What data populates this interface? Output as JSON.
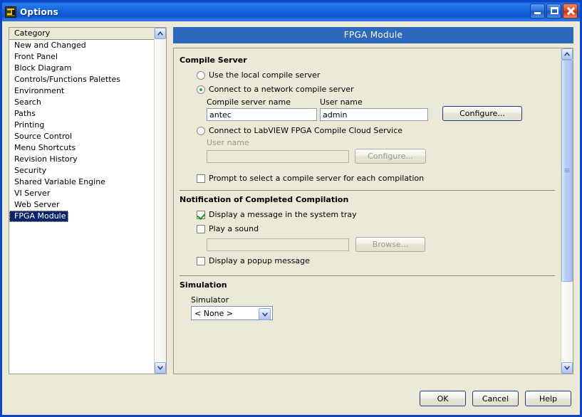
{
  "window": {
    "title": "Options",
    "icon": "labview-icon",
    "controls": {
      "minimize": "minimize-icon",
      "maximize": "maximize-icon",
      "close": "close-icon"
    }
  },
  "sidebar": {
    "header": "Category",
    "items": [
      {
        "label": "New and Changed",
        "selected": false
      },
      {
        "label": "Front Panel",
        "selected": false
      },
      {
        "label": "Block Diagram",
        "selected": false
      },
      {
        "label": "Controls/Functions Palettes",
        "selected": false
      },
      {
        "label": "Environment",
        "selected": false
      },
      {
        "label": "Search",
        "selected": false
      },
      {
        "label": "Paths",
        "selected": false
      },
      {
        "label": "Printing",
        "selected": false
      },
      {
        "label": "Source Control",
        "selected": false
      },
      {
        "label": "Menu Shortcuts",
        "selected": false
      },
      {
        "label": "Revision History",
        "selected": false
      },
      {
        "label": "Security",
        "selected": false
      },
      {
        "label": "Shared Variable Engine",
        "selected": false
      },
      {
        "label": "VI Server",
        "selected": false
      },
      {
        "label": "Web Server",
        "selected": false
      },
      {
        "label": "FPGA Module",
        "selected": true
      }
    ]
  },
  "panel": {
    "title": "FPGA Module",
    "sections": {
      "compile_server": {
        "title": "Compile Server",
        "radio_local": "Use the local compile server",
        "radio_network": "Connect to a network compile server",
        "radio_cloud": "Connect to LabVIEW FPGA Compile Cloud Service",
        "server_name_label": "Compile server name",
        "server_name_value": "antec",
        "user_name_label": "User name",
        "user_name_value": "admin",
        "configure_button": "Configure...",
        "cloud_user_name_label": "User name",
        "cloud_user_name_value": "",
        "cloud_configure_button": "Configure...",
        "prompt_checkbox": "Prompt to select a compile server for each compilation"
      },
      "notification": {
        "title": "Notification of Completed Compilation",
        "tray_checkbox": "Display a message in the system tray",
        "sound_checkbox": "Play a sound",
        "sound_path_value": "",
        "browse_button": "Browse...",
        "popup_checkbox": "Display a popup message"
      },
      "simulation": {
        "title": "Simulation",
        "simulator_label": "Simulator",
        "simulator_value": "< None >"
      }
    }
  },
  "footer": {
    "ok": "OK",
    "cancel": "Cancel",
    "help": "Help"
  },
  "colors": {
    "title_bar_blue": "#0A5BD3",
    "panel_header_blue": "#2E69BE",
    "window_bg": "#ECE9D8",
    "selection_blue": "#0A246A",
    "check_green": "#149414",
    "radio_green": "#2EA82E"
  }
}
